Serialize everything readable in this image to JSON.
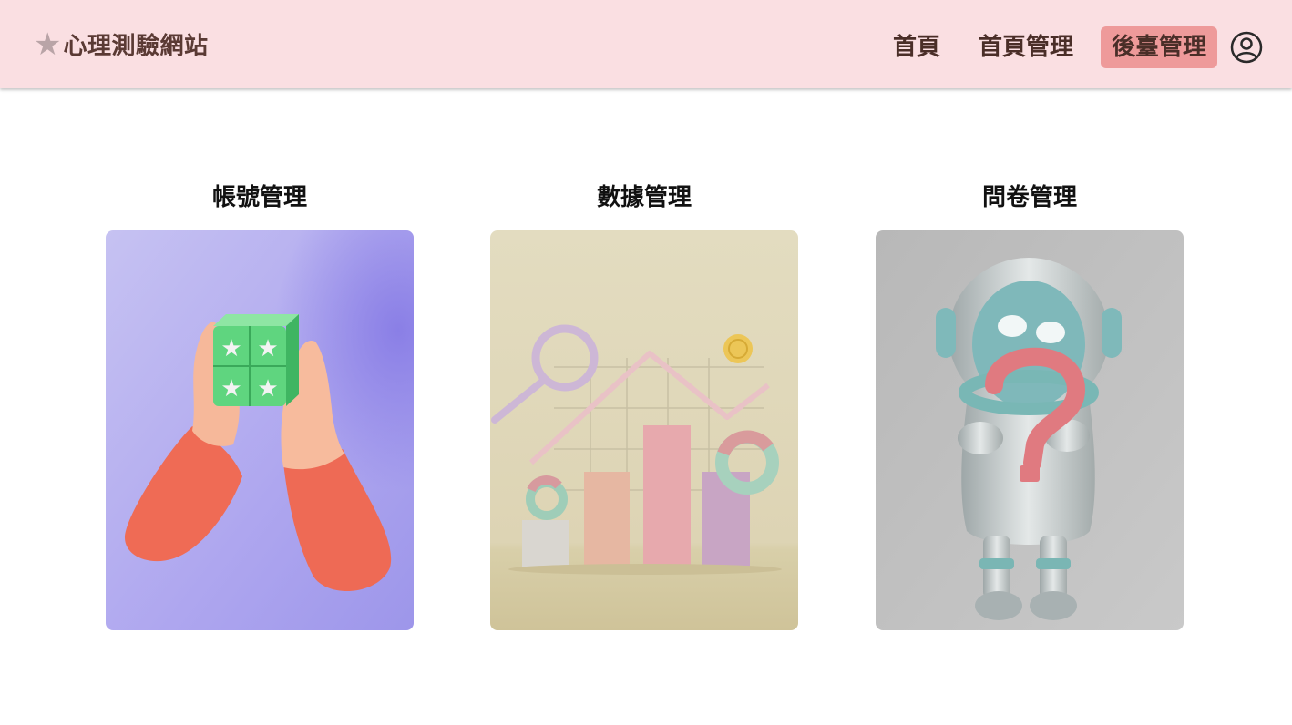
{
  "navbar": {
    "brand_star": "★",
    "brand_text": "心理測驗網站",
    "links": [
      {
        "label": "首頁",
        "active": false
      },
      {
        "label": "首頁管理",
        "active": false
      },
      {
        "label": "後臺管理",
        "active": true
      }
    ],
    "user_icon": "user-circle-icon"
  },
  "cards": [
    {
      "title": "帳號管理",
      "image": "hands-holding-star-blocks-illustration"
    },
    {
      "title": "數據管理",
      "image": "3d-bar-chart-magnifier-illustration"
    },
    {
      "title": "問卷管理",
      "image": "robot-question-mark-illustration"
    }
  ],
  "colors": {
    "navbar_bg": "#fadfe2",
    "active_link_bg": "#ee9a9a",
    "brand_text": "#5a3a34"
  }
}
